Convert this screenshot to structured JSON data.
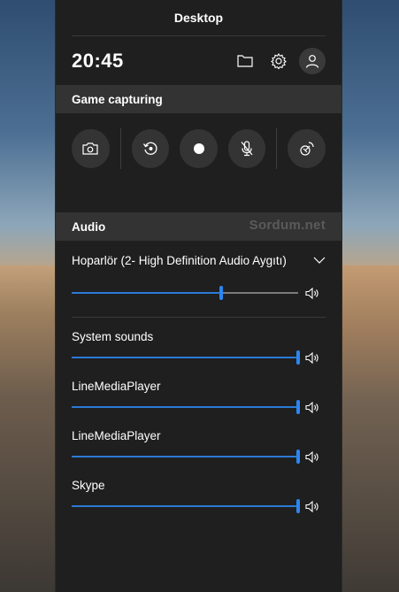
{
  "window": {
    "title": "Desktop"
  },
  "topbar": {
    "time": "20:45",
    "icons": [
      "folder-icon",
      "gear-icon",
      "user-icon"
    ]
  },
  "game_capturing": {
    "title": "Game capturing",
    "buttons": [
      "screenshot",
      "record-last",
      "start-recording",
      "microphone-off",
      "broadcast"
    ]
  },
  "audio": {
    "title": "Audio",
    "watermark": "Sordum.net",
    "device": {
      "name": "Hoparlör (2- High Definition Audio Aygıtı)",
      "volume": 0.66
    },
    "apps": [
      {
        "name": "System sounds",
        "volume": 1.0
      },
      {
        "name": "LineMediaPlayer",
        "volume": 1.0
      },
      {
        "name": "LineMediaPlayer",
        "volume": 1.0
      },
      {
        "name": "Skype",
        "volume": 1.0
      }
    ]
  },
  "colors": {
    "panel": "#1f1f1f",
    "header": "#333333",
    "accent": "#2b7ad6"
  }
}
